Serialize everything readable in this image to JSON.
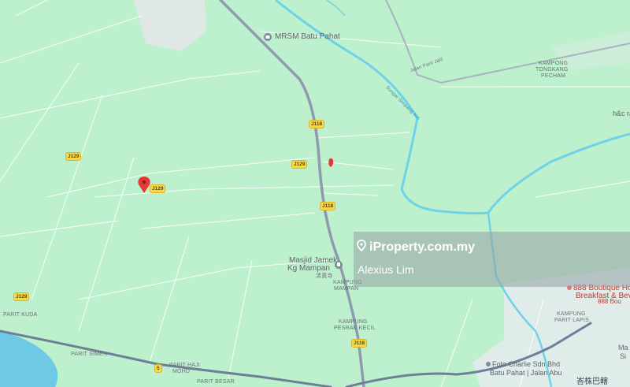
{
  "watermark": {
    "site": "iProperty.com.my",
    "agent": "Alexius Lim"
  },
  "places": {
    "mrsm": "MRSM Batu Pahat",
    "masjid_line1": "Masjid Jamek",
    "masjid_line2": "Kg Mampan",
    "masjid_cn": "清真寺",
    "kampong_tongkang_1": "KAMPONG",
    "kampong_tongkang_2": "TONGKANG",
    "kampong_tongkang_3": "PECHAM",
    "kampung_mampan_1": "KAMPUNG",
    "kampung_mampan_2": "MAMPAN",
    "kampung_pesrak_1": "KAMPUNG",
    "kampung_pesrak_2": "PESRAK KECIL",
    "kampung_parit_lapis_1": "KAMPUNG",
    "kampung_parit_lapis_2": "PARIT LAPIS",
    "hotel_1": "888 Boutique Hotel P",
    "hotel_2": "Breakfast & Beverag",
    "hotel_3": "888 Bou",
    "foto_1": "Foto Charlie Sdn Bhd",
    "foto_2": "Batu Pahat | Jalan Abu",
    "hc": "h&c ra",
    "parit_kuda": "PARIT KUDA",
    "parit_simen": "PARIT SIMEN",
    "parit_haji": "PARIT HAJI",
    "parit_haji_2": "MOHD",
    "parit_besar": "PARIT BESAR",
    "jalan_parit_jalil": "Jalan Parit Jalil",
    "sungai": "Sungai Simpang Kiri",
    "ma": "Ma",
    "si": "Si",
    "cn_bottom": "峇株巴轄"
  },
  "road_badges": {
    "j118_a": "J118",
    "j118_b": "J118",
    "j118_c": "J118",
    "j129_a": "J129",
    "j129_b": "J129",
    "j129_c": "J129",
    "j129_d": "J129",
    "route_5": "5"
  },
  "colors": {
    "land": "#bdf0cc",
    "water": "#6dd3e8",
    "highway": "#8f9aae",
    "pin": "#e53935"
  }
}
